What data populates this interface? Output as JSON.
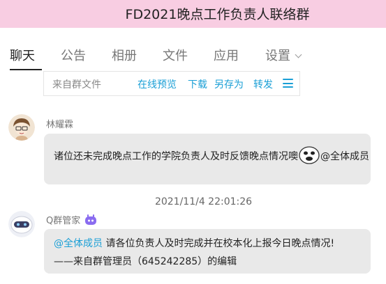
{
  "window": {
    "title": "FD2021晚点工作负责人联络群"
  },
  "tabs": [
    {
      "label": "聊天",
      "active": true
    },
    {
      "label": "公告"
    },
    {
      "label": "相册"
    },
    {
      "label": "文件"
    },
    {
      "label": "应用"
    },
    {
      "label": "设置"
    }
  ],
  "file_bar": {
    "source": "来自群文件",
    "actions": [
      "在线预览",
      "下载",
      "另存为",
      "转发"
    ]
  },
  "messages": [
    {
      "sender": "林耀霖",
      "line1": "诸位还未完成晚点工作的学院负责人及时反馈晚点情况噢",
      "mention_all": "@全体成员"
    },
    {
      "timestamp": "2021/11/4 22:01:26",
      "sender": "Q群管家",
      "mention": "@全体成员",
      "line1": " 请各位负责人及时完成并在校本化上报今日晚点情况!",
      "line2": "——来自群管理员（645242285）的编辑"
    }
  ],
  "colors": {
    "title_bar": "#f8cde2",
    "link": "#1a9fd6",
    "bubble": "#e9e9e9"
  }
}
